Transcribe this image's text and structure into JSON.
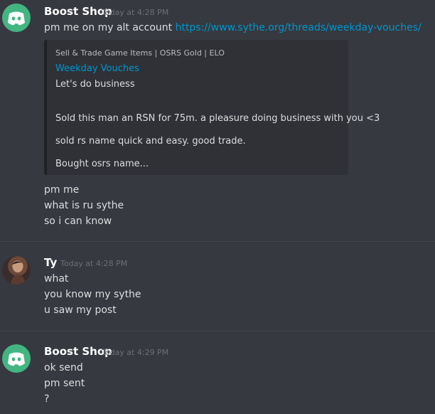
{
  "messages": [
    {
      "author": "Boost Shop",
      "timestamp": "Today at 4:28 PM",
      "avatar": "discord-logo-icon",
      "lines": [
        {
          "text": "pm me on my alt account ",
          "link": "https://www.sythe.org/threads/weekday-vouches/"
        }
      ],
      "embed": {
        "provider": "Sell & Trade Game Items | OSRS Gold | ELO",
        "title": "Weekday Vouches",
        "description": [
          "Let's do business",
          "Sold this man an RSN for 75m. a pleasure doing business with you <3",
          "sold rs name quick and easy. good trade.",
          "Bought osrs name..."
        ]
      },
      "extra_lines": [
        "pm me",
        "what is ru sythe",
        "so i can know"
      ]
    },
    {
      "author": "Ty",
      "timestamp": "Today at 4:28 PM",
      "avatar": "user-photo",
      "lines": [
        "what",
        "you know my sythe",
        "u saw my post"
      ]
    },
    {
      "author": "Boost Shop",
      "timestamp": "Today at 4:29 PM",
      "avatar": "discord-logo-icon",
      "lines": [
        "ok send",
        "pm sent",
        "?"
      ]
    }
  ],
  "colors": {
    "background": "#36393f",
    "author": "#ffffff",
    "text": "#dcddde",
    "link": "#0096cf",
    "timestamp": "#6c6f75",
    "embed_bg": "#2f3136",
    "discord_green": "#43b581"
  }
}
